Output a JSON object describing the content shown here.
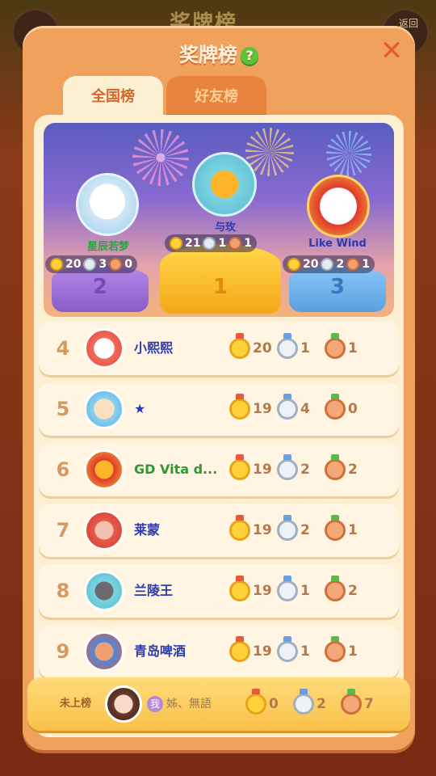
{
  "background": {
    "title": "奖牌榜",
    "back_label": "返回"
  },
  "dialog": {
    "title": "奖牌榜",
    "help_icon": "?",
    "close_icon": "✕"
  },
  "tabs": [
    {
      "label": "全国榜",
      "active": true
    },
    {
      "label": "好友榜",
      "active": false
    }
  ],
  "top3": [
    {
      "rank": "1",
      "name": "与玫",
      "gold": "21",
      "silver": "1",
      "bronze": "1"
    },
    {
      "rank": "2",
      "name": "星辰若梦",
      "gold": "20",
      "silver": "3",
      "bronze": "0"
    },
    {
      "rank": "3",
      "name": "Like Wind",
      "gold": "20",
      "silver": "2",
      "bronze": "1"
    }
  ],
  "rows": [
    {
      "rank": "4",
      "name": "小熙熙",
      "gold": "20",
      "silver": "1",
      "bronze": "1"
    },
    {
      "rank": "5",
      "name": "★",
      "gold": "19",
      "silver": "4",
      "bronze": "0"
    },
    {
      "rank": "6",
      "name": "GD Vita d...",
      "gold": "19",
      "silver": "2",
      "bronze": "2"
    },
    {
      "rank": "7",
      "name": "莱蒙",
      "gold": "19",
      "silver": "2",
      "bronze": "1"
    },
    {
      "rank": "8",
      "name": "兰陵王",
      "gold": "19",
      "silver": "1",
      "bronze": "2"
    },
    {
      "rank": "9",
      "name": "青岛啤酒",
      "gold": "19",
      "silver": "1",
      "bronze": "1"
    }
  ],
  "self": {
    "status": "未上榜",
    "me_tag": "我",
    "name": "姊、無語",
    "gold": "0",
    "silver": "2",
    "bronze": "7"
  },
  "colors": {
    "panel": "#f0a25c",
    "accent": "#e85a32",
    "name_blue": "#2a3ab0"
  }
}
